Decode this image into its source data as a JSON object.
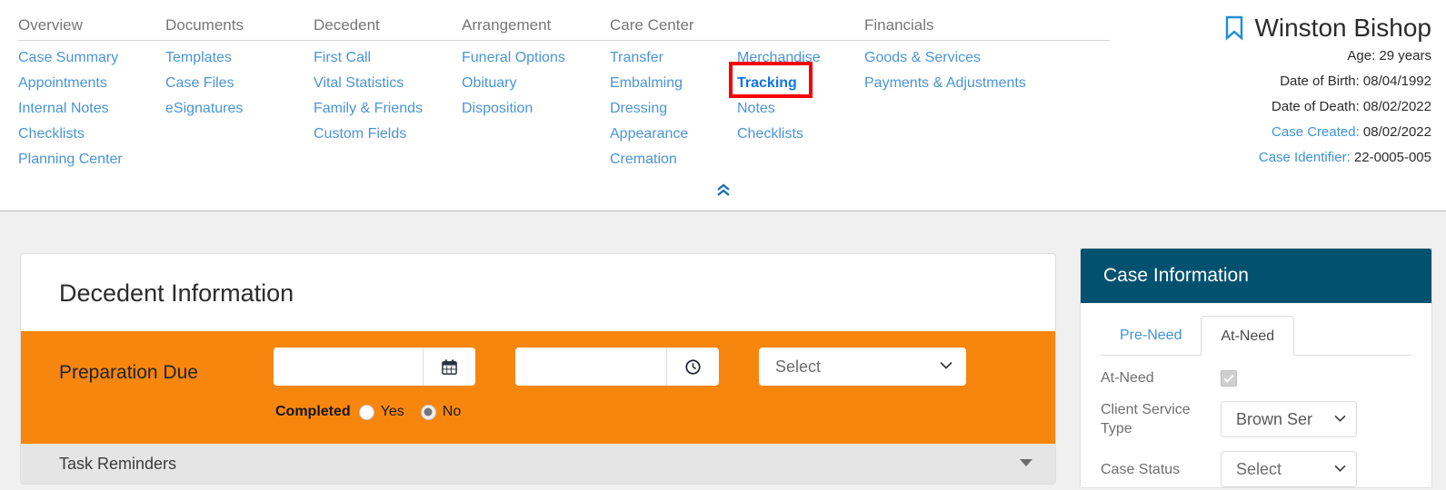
{
  "nav": {
    "columns": [
      {
        "heading": "Overview",
        "links": [
          "Case Summary",
          "Appointments",
          "Internal Notes",
          "Checklists",
          "Planning Center"
        ]
      },
      {
        "heading": "Documents",
        "links": [
          "Templates",
          "Case Files",
          "eSignatures"
        ]
      },
      {
        "heading": "Decedent",
        "links": [
          "First Call",
          "Vital Statistics",
          "Family & Friends",
          "Custom Fields"
        ]
      },
      {
        "heading": "Arrangement",
        "links": [
          "Funeral Options",
          "Obituary",
          "Disposition"
        ]
      }
    ],
    "care_center": {
      "heading": "Care Center",
      "left_links": [
        "Transfer",
        "Embalming",
        "Dressing",
        "Appearance",
        "Cremation"
      ],
      "right_links": [
        "Merchandise",
        "Tracking",
        "Notes",
        "Checklists"
      ],
      "active_link": "Tracking"
    },
    "financials": {
      "heading": "Financials",
      "links": [
        "Goods & Services",
        "Payments & Adjustments"
      ]
    },
    "collapse_icon": "double-chevron-up-icon"
  },
  "case_header": {
    "bookmark_icon": "bookmark-icon",
    "name": "Winston Bishop",
    "age_label": "Age:",
    "age_value": "29 years",
    "dob_label": "Date of Birth:",
    "dob_value": "08/04/1992",
    "dod_label": "Date of Death:",
    "dod_value": "08/02/2022",
    "created_label": "Case Created:",
    "created_value": "08/02/2022",
    "identifier_label": "Case Identifier:",
    "identifier_value": "22-0005-005"
  },
  "decedent_card": {
    "title": "Decedent Information",
    "prep": {
      "label": "Preparation Due",
      "date_value": "",
      "date_placeholder": "",
      "date_icon": "calendar-icon",
      "time_value": "",
      "time_placeholder": "",
      "time_icon": "clock-icon",
      "select_value": "Select",
      "select_caret_icon": "chevron-down-icon",
      "completed_label": "Completed",
      "options": [
        {
          "label": "Yes",
          "checked": false
        },
        {
          "label": "No",
          "checked": true
        }
      ]
    },
    "task_reminders": {
      "label": "Task Reminders",
      "toggle_icon": "caret-down-icon"
    }
  },
  "case_info": {
    "title": "Case Information",
    "tabs": [
      {
        "label": "Pre-Need",
        "active": false
      },
      {
        "label": "At-Need",
        "active": true
      }
    ],
    "rows": [
      {
        "label": "At-Need",
        "type": "checkbox",
        "checked": true,
        "check_icon": "check-icon"
      },
      {
        "label": "Client Service Type",
        "type": "select",
        "value": "Brown Ser",
        "caret_icon": "chevron-down-icon"
      },
      {
        "label": "Case Status",
        "type": "select",
        "value": "Select",
        "caret_icon": "chevron-down-icon"
      }
    ]
  },
  "colors": {
    "accent_orange": "#f7860e",
    "panel_teal": "#02516f",
    "link_blue": "#4a95d6",
    "active_blue": "#1273e6",
    "highlight_red": "#f50000",
    "page_bg": "#f0f0f0"
  }
}
